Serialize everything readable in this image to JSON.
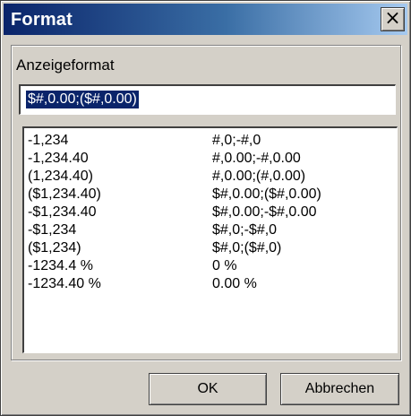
{
  "window": {
    "title": "Format",
    "close_glyph": "×"
  },
  "group": {
    "label": "Anzeigeformat"
  },
  "input": {
    "value": "$#,0.00;($#,0.00)"
  },
  "list": {
    "items": [
      {
        "example": "-1,234",
        "format": "#,0;-#,0"
      },
      {
        "example": "-1,234.40",
        "format": "#,0.00;-#,0.00"
      },
      {
        "example": "(1,234.40)",
        "format": "#,0.00;(#,0.00)"
      },
      {
        "example": "($1,234.40)",
        "format": "$#,0.00;($#,0.00)"
      },
      {
        "example": "-$1,234.40",
        "format": "$#,0.00;-$#,0.00"
      },
      {
        "example": "-$1,234",
        "format": "$#,0;-$#,0"
      },
      {
        "example": "($1,234)",
        "format": "$#,0;($#,0)"
      },
      {
        "example": "-1234.4 %",
        "format": "0 %"
      },
      {
        "example": "-1234.40 %",
        "format": "0.00 %"
      }
    ]
  },
  "buttons": {
    "ok": "OK",
    "cancel": "Abbrechen"
  },
  "colors": {
    "title_gradient_start": "#0a246a",
    "title_gradient_end": "#a6caf0",
    "dialog_face": "#d4d0c8",
    "selection": "#0a246a"
  }
}
